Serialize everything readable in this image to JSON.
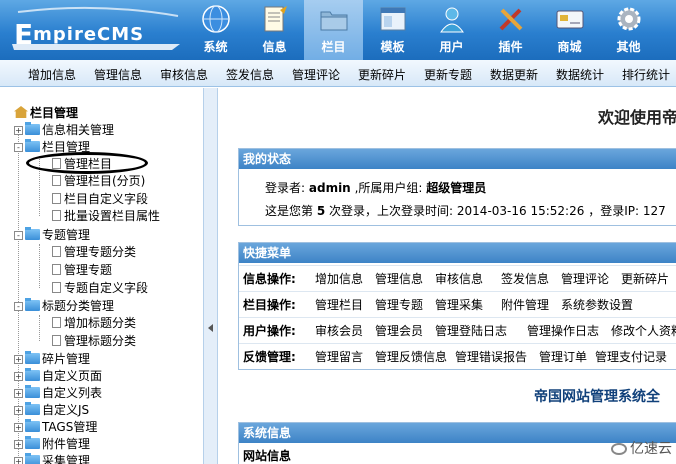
{
  "logo": {
    "initial": "E",
    "rest": "mpireCMS"
  },
  "topnav": [
    {
      "label": "系统",
      "icon": "globe-icon"
    },
    {
      "label": "信息",
      "icon": "document-icon"
    },
    {
      "label": "栏目",
      "icon": "folder-icon"
    },
    {
      "label": "模板",
      "icon": "window-icon"
    },
    {
      "label": "用户",
      "icon": "user-icon"
    },
    {
      "label": "插件",
      "icon": "tools-icon"
    },
    {
      "label": "商城",
      "icon": "card-icon"
    },
    {
      "label": "其他",
      "icon": "gear-icon"
    }
  ],
  "active_topnav": "栏目",
  "submenu": [
    "增加信息",
    "管理信息",
    "审核信息",
    "签发信息",
    "管理评论",
    "更新碎片",
    "更新专题",
    "数据更新",
    "数据统计",
    "排行统计"
  ],
  "tree": {
    "root": "栏目管理",
    "nodes": [
      {
        "label": "信息相关管理",
        "expander": "+"
      },
      {
        "label": "栏目管理",
        "expander": "-"
      },
      {
        "label": "管理栏目"
      },
      {
        "label": "管理栏目(分页)"
      },
      {
        "label": "栏目自定义字段"
      },
      {
        "label": "批量设置栏目属性"
      },
      {
        "label": "专题管理",
        "expander": "-"
      },
      {
        "label": "管理专题分类"
      },
      {
        "label": "管理专题"
      },
      {
        "label": "专题自定义字段"
      },
      {
        "label": "标题分类管理",
        "expander": "-"
      },
      {
        "label": "增加标题分类"
      },
      {
        "label": "管理标题分类"
      },
      {
        "label": "碎片管理",
        "expander": "+"
      },
      {
        "label": "自定义页面",
        "expander": "+"
      },
      {
        "label": "自定义列表",
        "expander": "+"
      },
      {
        "label": "自定义JS",
        "expander": "+"
      },
      {
        "label": "TAGS管理",
        "expander": "+"
      },
      {
        "label": "附件管理",
        "expander": "+"
      },
      {
        "label": "采集管理",
        "expander": "+"
      }
    ]
  },
  "main": {
    "welcome": "欢迎使用帝",
    "status": {
      "title": "我的状态",
      "login_label": "登录者:",
      "login_user": "admin",
      "group_label": ",所属用户组:",
      "group_name": "超级管理员",
      "count_prefix": "这是您第",
      "count": "5",
      "count_suffix": "次登录，上次登录时间:",
      "last_time": "2014-03-16 15:52:26",
      "ip_label": "，登录IP:",
      "ip": "127"
    },
    "quick": {
      "title": "快捷菜单",
      "rows": [
        {
          "label": "信息操作:",
          "links": [
            "增加信息",
            "管理信息",
            "审核信息",
            "签发信息",
            "管理评论",
            "更新碎片"
          ]
        },
        {
          "label": "栏目操作:",
          "links": [
            "管理栏目",
            "管理专题",
            "管理采集",
            "附件管理",
            "系统参数设置"
          ]
        },
        {
          "label": "用户操作:",
          "links": [
            "审核会员",
            "管理会员",
            "管理登陆日志",
            "管理操作日志",
            "修改个人资料"
          ]
        },
        {
          "label": "反馈管理:",
          "links": [
            "管理留言",
            "管理反馈信息",
            "管理错误报告",
            "管理订单",
            "管理支付记录"
          ]
        }
      ]
    },
    "system_title": "帝国网站管理系统全",
    "sysinfo": {
      "title": "系统信息",
      "row": "网站信息"
    },
    "watermark": "亿速云"
  }
}
